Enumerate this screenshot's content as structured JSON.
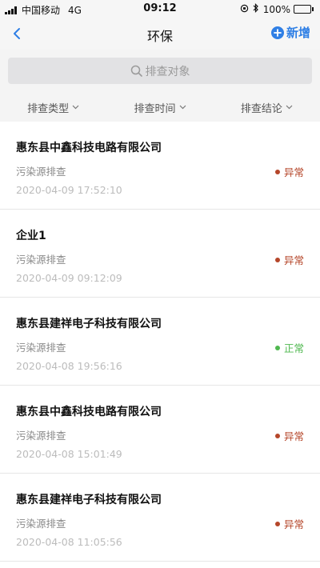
{
  "status_bar": {
    "carrier": "中国移动",
    "network": "4G",
    "time": "09:12",
    "battery": "100%",
    "battery_level": 1.0
  },
  "nav": {
    "title": "环保",
    "add_label": "新增"
  },
  "search": {
    "placeholder": "排查对象"
  },
  "filters": [
    {
      "label": "排查类型"
    },
    {
      "label": "排查时间"
    },
    {
      "label": "排查结论"
    }
  ],
  "items": [
    {
      "name": "惠东县中鑫科技电路有限公司",
      "type": "污染源排查",
      "time": "2020-04-09 17:52:10",
      "status": "异常",
      "status_color": "#b5462a"
    },
    {
      "name": "企业1",
      "type": "污染源排查",
      "time": "2020-04-09 09:12:09",
      "status": "异常",
      "status_color": "#b5462a"
    },
    {
      "name": "惠东县建祥电子科技有限公司",
      "type": "污染源排查",
      "time": "2020-04-08 19:56:16",
      "status": "正常",
      "status_color": "#4fb84f"
    },
    {
      "name": "惠东县中鑫科技电路有限公司",
      "type": "污染源排查",
      "time": "2020-04-08 15:01:49",
      "status": "异常",
      "status_color": "#b5462a"
    },
    {
      "name": "惠东县建祥电子科技有限公司",
      "type": "污染源排查",
      "time": "2020-04-08 11:05:56",
      "status": "异常",
      "status_color": "#b5462a"
    }
  ],
  "colors": {
    "accent": "#2f7fe5",
    "abnormal": "#b5462a",
    "normal": "#4fb84f"
  }
}
